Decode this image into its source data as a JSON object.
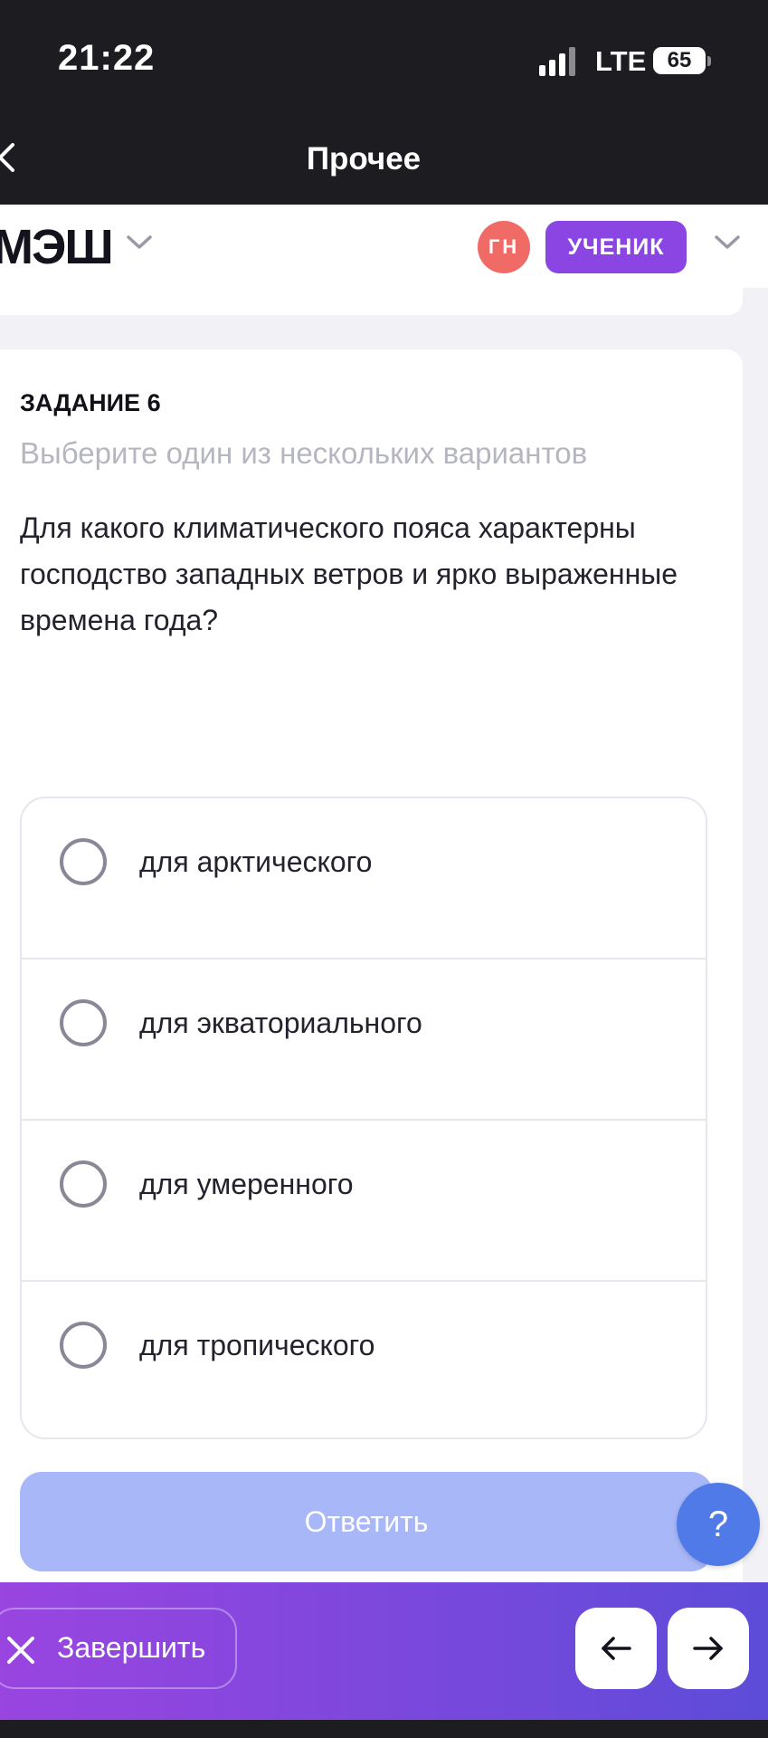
{
  "status_bar": {
    "time": "21:22",
    "network": "LTE",
    "battery": "65"
  },
  "nav_bar": {
    "title": "Прочее"
  },
  "app_header": {
    "logo": "МЭШ",
    "avatar_initials": "ГН",
    "role": "УЧЕНИК"
  },
  "task": {
    "number_label": "ЗАДАНИЕ 6",
    "hint": "Выберите один из нескольких вариантов",
    "question": "Для какого климатического пояса характерны господство западных ветров и ярко выраженные времена года?",
    "options": [
      {
        "label": "для арктического",
        "selected": false
      },
      {
        "label": "для экваториального",
        "selected": false
      },
      {
        "label": "для умеренного",
        "selected": false
      },
      {
        "label": "для тропического",
        "selected": false
      }
    ],
    "submit_label": "Ответить"
  },
  "help": {
    "label": "?"
  },
  "footer": {
    "finish_label": "Завершить",
    "prev_icon": "arrow-left-icon",
    "next_icon": "arrow-right-icon"
  },
  "colors": {
    "accent_purple": "#8b45e3",
    "submit_disabled": "#a7b7f7",
    "help_blue": "#4f7ae8",
    "avatar_red": "#f06a66"
  }
}
